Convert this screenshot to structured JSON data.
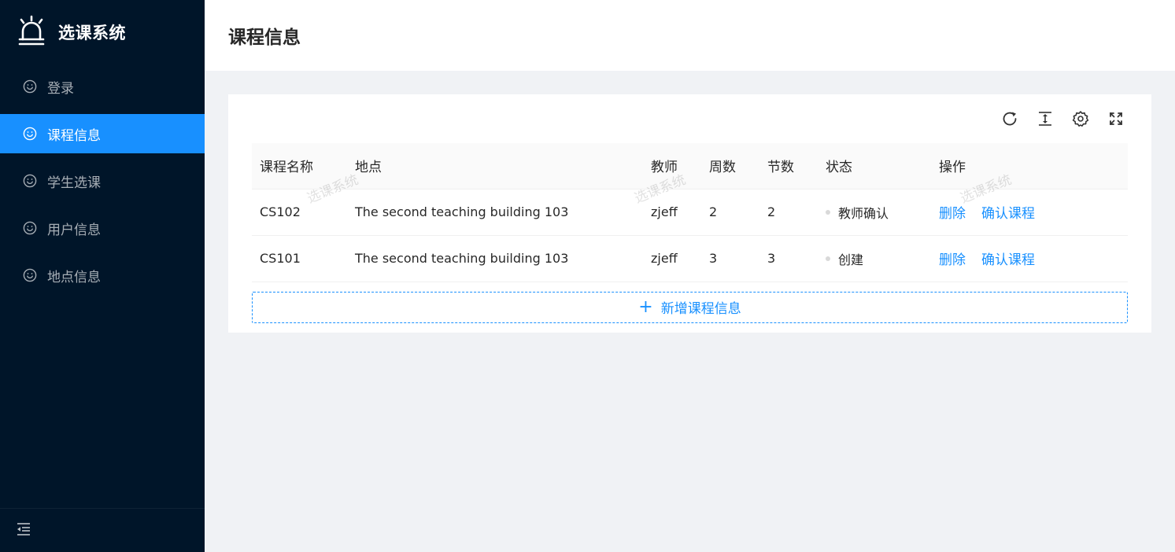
{
  "app": {
    "name": "选课系统"
  },
  "sidebar": {
    "items": [
      {
        "label": "登录",
        "active": false
      },
      {
        "label": "课程信息",
        "active": true
      },
      {
        "label": "学生选课",
        "active": false
      },
      {
        "label": "用户信息",
        "active": false
      },
      {
        "label": "地点信息",
        "active": false
      }
    ],
    "collapse_icon": "menu-fold-icon",
    "item_icon": "smile-icon"
  },
  "header": {
    "title": "课程信息"
  },
  "toolbar": {
    "icons": [
      "reload-icon",
      "column-height-icon",
      "setting-icon",
      "fullscreen-icon"
    ]
  },
  "table": {
    "columns": [
      "课程名称",
      "地点",
      "教师",
      "周数",
      "节数",
      "状态",
      "操作"
    ],
    "rows": [
      {
        "name": "CS102",
        "location": "The second teaching building 103",
        "teacher": "zjeff",
        "weeks": "2",
        "sections": "2",
        "status": "教师确认",
        "actions": [
          "删除",
          "确认课程"
        ]
      },
      {
        "name": "CS101",
        "location": "The second teaching building 103",
        "teacher": "zjeff",
        "weeks": "3",
        "sections": "3",
        "status": "创建",
        "actions": [
          "删除",
          "确认课程"
        ]
      }
    ]
  },
  "add_button": {
    "label": "新增课程信息"
  },
  "watermark": {
    "text": "选课系统"
  },
  "colors": {
    "sider_bg": "#001529",
    "accent": "#1890ff",
    "content_bg": "#f0f2f5"
  }
}
